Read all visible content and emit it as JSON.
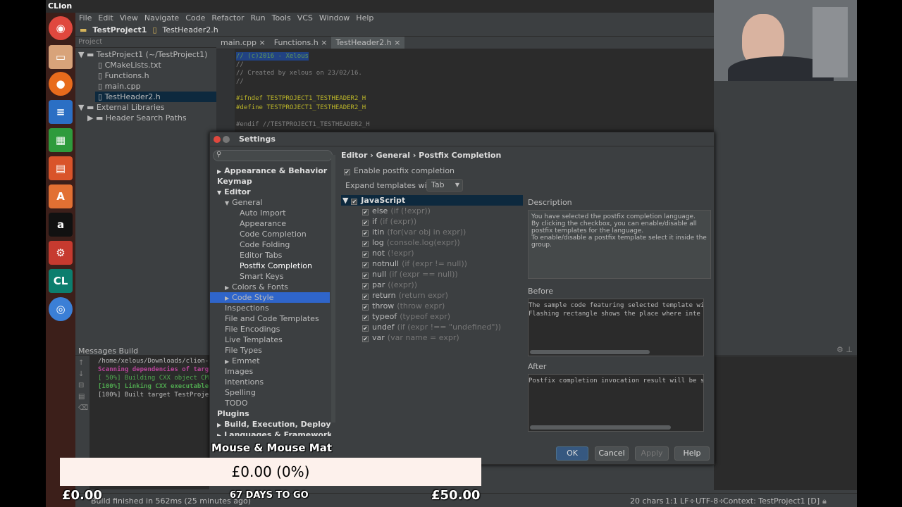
{
  "window": {
    "title": "CLion"
  },
  "menu": [
    "File",
    "Edit",
    "View",
    "Navigate",
    "Code",
    "Refactor",
    "Run",
    "Tools",
    "VCS",
    "Window",
    "Help"
  ],
  "nav": {
    "project": "TestProject1",
    "file": "TestHeader2.h"
  },
  "project_panel": {
    "header": "Project",
    "items": [
      "TestProject1 (~/TestProject1)",
      "CMakeLists.txt",
      "Functions.h",
      "main.cpp",
      "TestHeader2.h",
      "External Libraries",
      "Header Search Paths"
    ]
  },
  "editor": {
    "tabs": [
      "main.cpp",
      "Functions.h",
      "TestHeader2.h"
    ],
    "lines": [
      "// (c)2016 - Xelous",
      "//",
      "// Created by xelous on 23/02/16.",
      "//",
      "",
      "#ifndef TESTPROJECT1_TESTHEADER2_H",
      "#define TESTPROJECT1_TESTHEADER2_H",
      "",
      "#endif //TESTPROJECT1_TESTHEADER2_H"
    ]
  },
  "messages": {
    "title": "Messages Build",
    "lines": [
      "/home/xelous/Downloads/clion-",
      "Scanning dependencies of targ",
      "[ 50%] Building CXX object CM",
      "[100%] Linking CXX executable",
      "[100%] Built target TestProje"
    ]
  },
  "status": {
    "left": "Build finished in 562ms (25 minutes ago)",
    "chars": "20 chars",
    "pos": "1:1",
    "lf": "LF÷",
    "enc": "UTF-8÷",
    "context": "Context: TestProject1 [D]"
  },
  "settings": {
    "title": "Settings",
    "breadcrumb": "Editor › General › Postfix Completion",
    "tree": [
      {
        "label": "Appearance & Behavior",
        "bold": true,
        "arrow": "▶",
        "indent": 0
      },
      {
        "label": "Keymap",
        "bold": true,
        "arrow": "",
        "indent": 0
      },
      {
        "label": "Editor",
        "bold": true,
        "arrow": "▼",
        "indent": 0
      },
      {
        "label": "General",
        "bold": false,
        "arrow": "▼",
        "indent": 1
      },
      {
        "label": "Auto Import",
        "bold": false,
        "arrow": "",
        "indent": 2
      },
      {
        "label": "Appearance",
        "bold": false,
        "arrow": "",
        "indent": 2
      },
      {
        "label": "Code Completion",
        "bold": false,
        "arrow": "",
        "indent": 2
      },
      {
        "label": "Code Folding",
        "bold": false,
        "arrow": "",
        "indent": 2
      },
      {
        "label": "Editor Tabs",
        "bold": false,
        "arrow": "",
        "indent": 2
      },
      {
        "label": "Postfix Completion",
        "bold": false,
        "arrow": "",
        "indent": 2
      },
      {
        "label": "Smart Keys",
        "bold": false,
        "arrow": "",
        "indent": 2
      },
      {
        "label": "Colors & Fonts",
        "bold": false,
        "arrow": "▶",
        "indent": 1
      },
      {
        "label": "Code Style",
        "bold": false,
        "arrow": "▶",
        "indent": 1
      },
      {
        "label": "Inspections",
        "bold": false,
        "arrow": "",
        "indent": 1
      },
      {
        "label": "File and Code Templates",
        "bold": false,
        "arrow": "",
        "indent": 1
      },
      {
        "label": "File Encodings",
        "bold": false,
        "arrow": "",
        "indent": 1
      },
      {
        "label": "Live Templates",
        "bold": false,
        "arrow": "",
        "indent": 1
      },
      {
        "label": "File Types",
        "bold": false,
        "arrow": "",
        "indent": 1
      },
      {
        "label": "Emmet",
        "bold": false,
        "arrow": "▶",
        "indent": 1
      },
      {
        "label": "Images",
        "bold": false,
        "arrow": "",
        "indent": 1
      },
      {
        "label": "Intentions",
        "bold": false,
        "arrow": "",
        "indent": 1
      },
      {
        "label": "Spelling",
        "bold": false,
        "arrow": "",
        "indent": 1
      },
      {
        "label": "TODO",
        "bold": false,
        "arrow": "",
        "indent": 1
      },
      {
        "label": "Plugins",
        "bold": true,
        "arrow": "",
        "indent": 0
      },
      {
        "label": "Build, Execution, Deployment",
        "bold": true,
        "arrow": "▶",
        "indent": 0
      },
      {
        "label": "Languages & Frameworks",
        "bold": true,
        "arrow": "▶",
        "indent": 0
      }
    ],
    "enable_label": "Enable postfix completion",
    "expand_label": "Expand templates with",
    "expand_value": "Tab",
    "lang": "JavaScript",
    "templates": [
      {
        "name": "else",
        "hint": "(if (!expr))"
      },
      {
        "name": "if",
        "hint": "(if (expr))"
      },
      {
        "name": "itin",
        "hint": "(for(var obj in expr))"
      },
      {
        "name": "log",
        "hint": "(console.log(expr))"
      },
      {
        "name": "not",
        "hint": "(!expr)"
      },
      {
        "name": "notnull",
        "hint": "(if (expr != null))"
      },
      {
        "name": "null",
        "hint": "(if (expr == null))"
      },
      {
        "name": "par",
        "hint": "((expr))"
      },
      {
        "name": "return",
        "hint": "(return expr)"
      },
      {
        "name": "throw",
        "hint": "(throw expr)"
      },
      {
        "name": "typeof",
        "hint": "(typeof expr)"
      },
      {
        "name": "undef",
        "hint": "(if (expr !== \"undefined\"))"
      },
      {
        "name": "var",
        "hint": "(var name = expr)"
      }
    ],
    "description_title": "Description",
    "description": [
      "You have selected the postfix completion language.",
      "By clicking the checkbox, you can enable/disable all",
      "postfix templates for the language.",
      "To enable/disable a postfix template select it inside the",
      "group."
    ],
    "before_title": "Before",
    "before": [
      "The sample code featuring selected template wi",
      "Flashing rectangle shows the place where inte"
    ],
    "after_title": "After",
    "after": "Postfix completion invocation result will be s",
    "buttons": {
      "ok": "OK",
      "cancel": "Cancel",
      "apply": "Apply",
      "help": "Help"
    }
  },
  "overlay": {
    "label": "Mouse & Mouse Mat",
    "amount": "£0.00 (0%)",
    "left": "£0.00",
    "days": "67 DAYS TO GO",
    "right": "£50.00"
  }
}
